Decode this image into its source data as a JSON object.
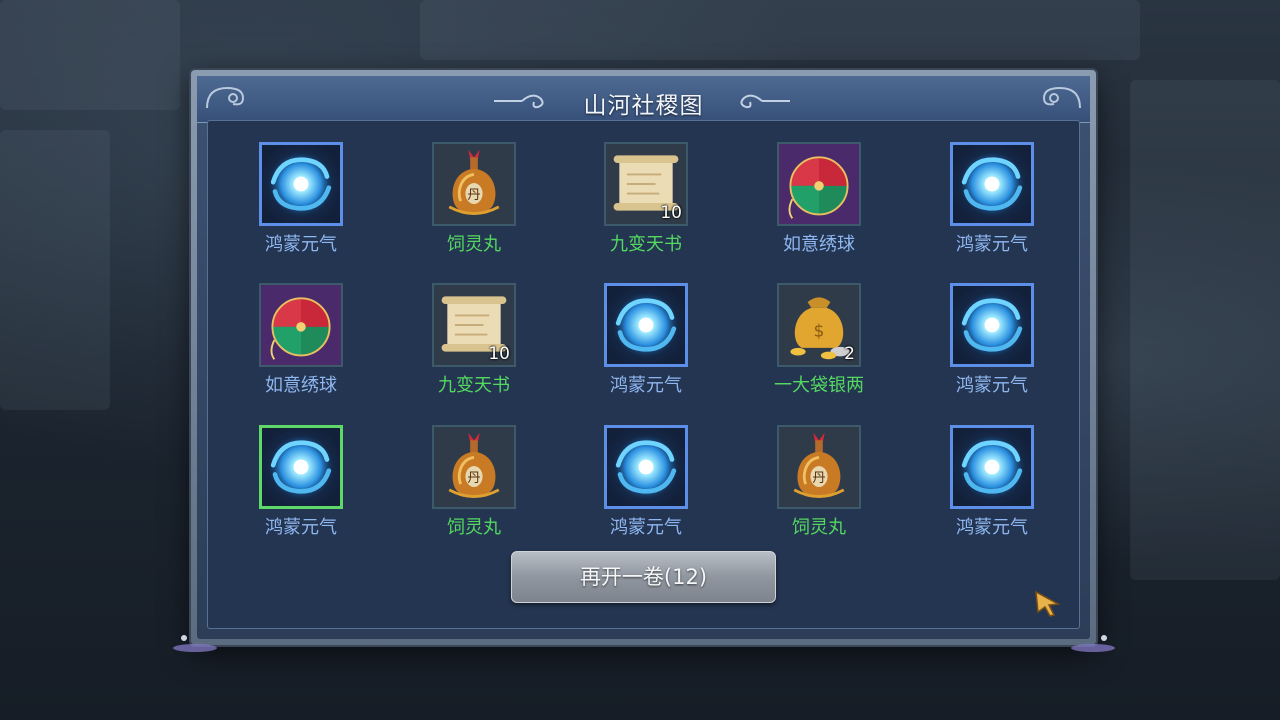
{
  "dialog": {
    "title": "山河社稷图",
    "reopen_button_label": "再开一卷(12)"
  },
  "items": [
    {
      "label": "鸿蒙元气",
      "icon": "swirl-orb-icon",
      "count": "",
      "label_color": "blue",
      "selected": false
    },
    {
      "label": "饲灵丸",
      "icon": "gourd-pill-icon",
      "count": "",
      "label_color": "green",
      "selected": false
    },
    {
      "label": "九变天书",
      "icon": "scroll-icon",
      "count": "10",
      "label_color": "green",
      "selected": false
    },
    {
      "label": "如意绣球",
      "icon": "embroidered-ball-icon",
      "count": "",
      "label_color": "blue",
      "selected": false
    },
    {
      "label": "鸿蒙元气",
      "icon": "swirl-orb-icon",
      "count": "",
      "label_color": "blue",
      "selected": false
    },
    {
      "label": "如意绣球",
      "icon": "embroidered-ball-icon",
      "count": "",
      "label_color": "blue",
      "selected": false
    },
    {
      "label": "九变天书",
      "icon": "scroll-icon",
      "count": "10",
      "label_color": "green",
      "selected": false
    },
    {
      "label": "鸿蒙元气",
      "icon": "swirl-orb-icon",
      "count": "",
      "label_color": "blue",
      "selected": false
    },
    {
      "label": "一大袋银两",
      "icon": "money-bag-icon",
      "count": "2",
      "label_color": "green",
      "selected": false
    },
    {
      "label": "鸿蒙元气",
      "icon": "swirl-orb-icon",
      "count": "",
      "label_color": "blue",
      "selected": false
    },
    {
      "label": "鸿蒙元气",
      "icon": "swirl-orb-icon",
      "count": "",
      "label_color": "blue",
      "selected": true
    },
    {
      "label": "饲灵丸",
      "icon": "gourd-pill-icon",
      "count": "",
      "label_color": "green",
      "selected": false
    },
    {
      "label": "鸿蒙元气",
      "icon": "swirl-orb-icon",
      "count": "",
      "label_color": "blue",
      "selected": false
    },
    {
      "label": "饲灵丸",
      "icon": "gourd-pill-icon",
      "count": "",
      "label_color": "green",
      "selected": false
    },
    {
      "label": "鸿蒙元气",
      "icon": "swirl-orb-icon",
      "count": "",
      "label_color": "blue",
      "selected": false
    }
  ],
  "colors": {
    "label_blue": "#8fb7f0",
    "label_green": "#54d860",
    "selected_border": "#5fd86a",
    "orb_border": "#5d8ee8"
  }
}
